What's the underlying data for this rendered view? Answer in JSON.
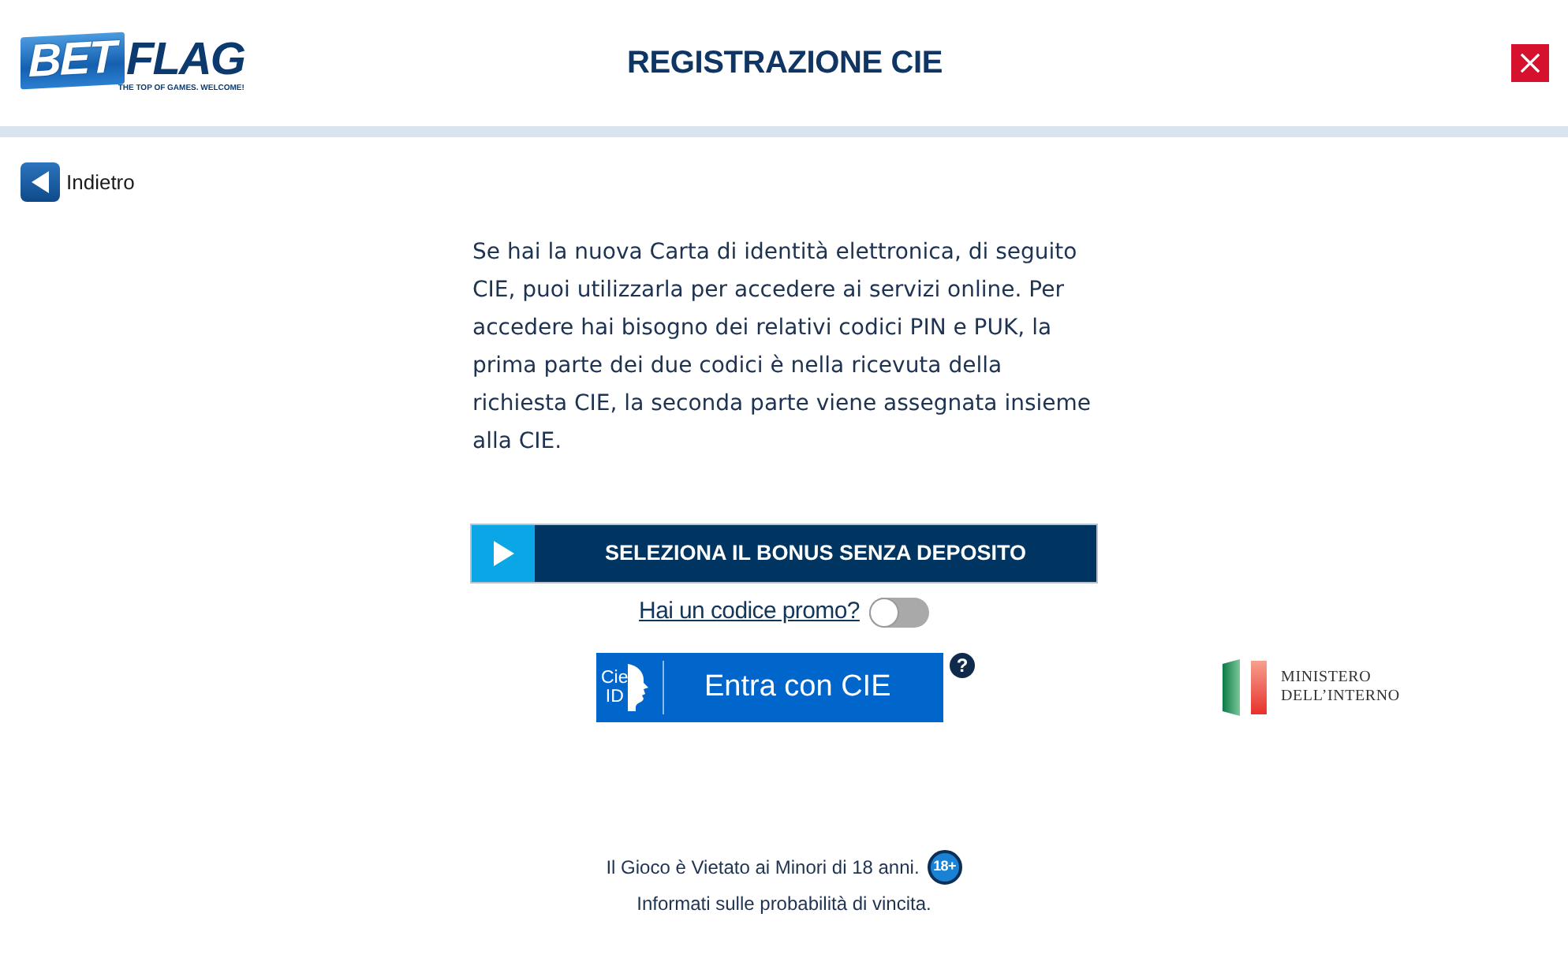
{
  "header": {
    "logo": {
      "word_1": "BET",
      "word_2": "FLAG",
      "tagline": "THE TOP OF GAMES. WELCOME!"
    },
    "title": "REGISTRAZIONE CIE"
  },
  "back_link": {
    "label": "Indietro"
  },
  "intro": "Se hai la nuova Carta di identità elettronica, di seguito CIE, puoi utilizzarla per accedere ai servizi online. Per accedere hai bisogno dei relativi codici PIN e PUK, la prima parte dei due codici è nella ricevuta della richiesta CIE, la seconda parte viene assegnata insieme alla CIE.",
  "bonus_button": {
    "label": "SELEZIONA IL BONUS SENZA DEPOSITO"
  },
  "promo": {
    "label": "Hai un codice promo?",
    "on": false
  },
  "cie_button": {
    "logo_top": "Cie",
    "logo_bottom": "ID",
    "label": "Entra con CIE"
  },
  "help_icon": "?",
  "ministry_logo": {
    "line_1": "MINISTERO",
    "line_2": "DELL’INTERNO"
  },
  "footer": {
    "age_notice": "Il Gioco è Vietato ai Minori di 18 anni.",
    "age_badge": "18+",
    "odds_link": "Informati sulle probabilità di vincita."
  }
}
